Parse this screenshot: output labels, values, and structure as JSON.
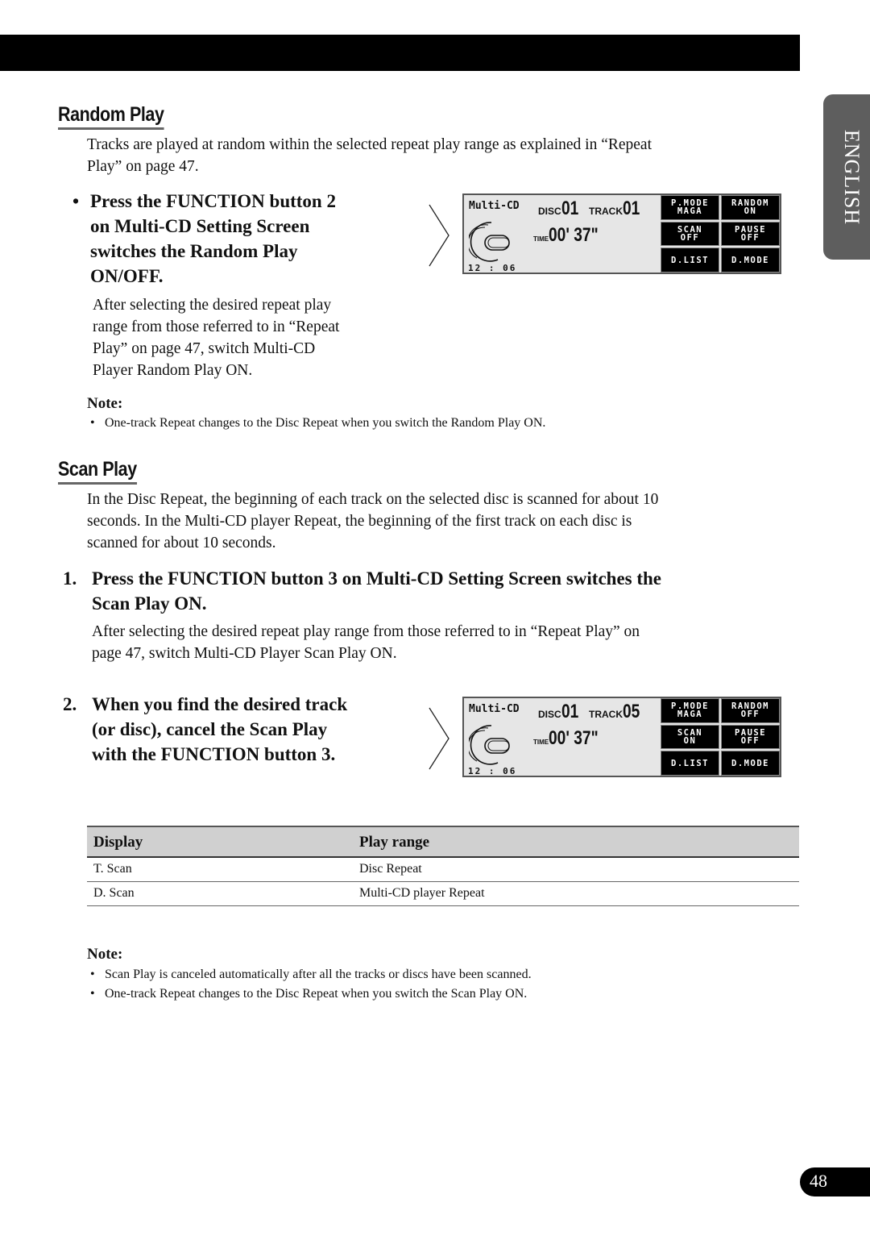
{
  "side_tab": {
    "label": "ENGLISH"
  },
  "page_number": "48",
  "random_play": {
    "heading": "Random Play",
    "intro": [
      "Tracks are played at random within the selected repeat play range as explained in “Repeat",
      "Play” on page 47."
    ],
    "step": {
      "bullet": "•",
      "lines": [
        "Press the FUNCTION button 2",
        "on Multi-CD Setting Screen",
        "switches the Random Play",
        "ON/OFF."
      ],
      "detail": [
        "After selecting the desired repeat play",
        "range from those referred to in “Repeat",
        "Play” on page 47, switch Multi-CD",
        "Player Random Play ON."
      ]
    },
    "note_label": "Note:",
    "notes": [
      "One-track Repeat changes to the Disc Repeat when you switch the Random Play ON."
    ],
    "display": {
      "mode": "Multi-CD",
      "disc_label": "DISC",
      "disc": "01",
      "track_label": "TRACK",
      "track": "01",
      "time_label": "TIME",
      "time": "00' 37\"",
      "clock": "12 : 06",
      "buttons": [
        {
          "line1": "P.MODE",
          "line2": "MAGA"
        },
        {
          "line1": "RANDOM",
          "line2": "ON"
        },
        {
          "line1": "SCAN",
          "line2": "OFF"
        },
        {
          "line1": "PAUSE",
          "line2": "OFF"
        },
        {
          "line1": "D.LIST",
          "line2": ""
        },
        {
          "line1": "D.MODE",
          "line2": ""
        }
      ]
    }
  },
  "scan_play": {
    "heading": "Scan Play",
    "intro": [
      "In the Disc Repeat, the beginning of each track on the selected disc is scanned for about 10",
      "seconds. In the Multi-CD player Repeat, the beginning of the first track on each disc is",
      "scanned for about 10 seconds."
    ],
    "step1": {
      "number": "1.",
      "lines": [
        "Press the FUNCTION button 3 on Multi-CD Setting Screen switches the",
        "Scan Play ON."
      ],
      "detail": [
        "After selecting the desired repeat play range from those referred to in “Repeat Play” on",
        "page 47, switch Multi-CD Player Scan Play ON."
      ]
    },
    "step2": {
      "number": "2.",
      "lines": [
        "When you find the desired track",
        "(or disc), cancel the Scan Play",
        "with the FUNCTION button 3."
      ]
    },
    "display": {
      "mode": "Multi-CD",
      "disc_label": "DISC",
      "disc": "01",
      "track_label": "TRACK",
      "track": "05",
      "time_label": "TIME",
      "time": "00' 37\"",
      "clock": "12 : 06",
      "buttons": [
        {
          "line1": "P.MODE",
          "line2": "MAGA"
        },
        {
          "line1": "RANDOM",
          "line2": "OFF"
        },
        {
          "line1": "SCAN",
          "line2": "ON"
        },
        {
          "line1": "PAUSE",
          "line2": "OFF"
        },
        {
          "line1": "D.LIST",
          "line2": ""
        },
        {
          "line1": "D.MODE",
          "line2": ""
        }
      ]
    },
    "table": {
      "headers": [
        "Display",
        "Play range"
      ],
      "rows": [
        [
          "T. Scan",
          "Disc Repeat"
        ],
        [
          "D. Scan",
          "Multi-CD player Repeat"
        ]
      ]
    },
    "note_label": "Note:",
    "notes": [
      "Scan Play is canceled automatically after all the tracks or discs have been scanned.",
      "One-track Repeat changes to the Disc Repeat when you switch the Scan Play ON."
    ]
  }
}
